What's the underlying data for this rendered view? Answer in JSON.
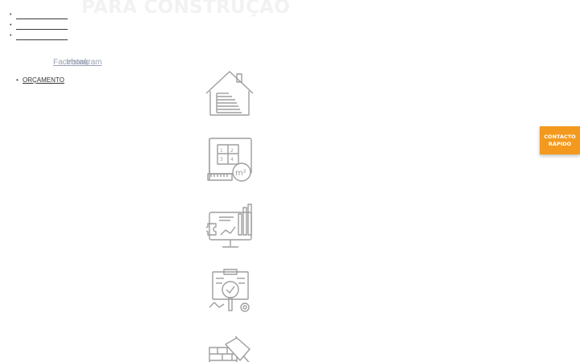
{
  "hero": {
    "title": "PARA CONSTRUÇÃO"
  },
  "top_links": [
    {
      "label": ""
    },
    {
      "label": ""
    },
    {
      "label": ""
    }
  ],
  "social": {
    "facebook": "Facebook",
    "instagram": "Instagram"
  },
  "menu": {
    "items": [
      {
        "label": "ORÇAMENTO"
      }
    ]
  },
  "services": [
    {
      "icon": "house-icon"
    },
    {
      "icon": "blueprint-icon"
    },
    {
      "icon": "analytics-monitor-icon"
    },
    {
      "icon": "inspection-icon"
    },
    {
      "icon": "brick-trowel-icon"
    }
  ],
  "quick_contact": {
    "line1": "CONTACTO",
    "line2": "RÁPIDO"
  },
  "colors": {
    "accent": "#f39a1e",
    "icon_stroke": "#9e9e9e",
    "social_link": "#9aa2b5"
  }
}
